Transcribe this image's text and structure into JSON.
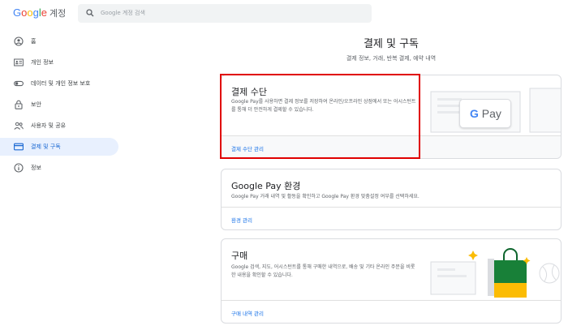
{
  "header": {
    "logo": {
      "g1": "G",
      "o1": "o",
      "o2": "o",
      "g2": "g",
      "l": "l",
      "e": "e",
      "account": "계정"
    },
    "search_placeholder": "Google 계정 검색"
  },
  "sidebar": {
    "items": [
      {
        "label": "홈",
        "icon": "home-icon"
      },
      {
        "label": "개인 정보",
        "icon": "id-card-icon"
      },
      {
        "label": "데이터 및 개인 정보 보호",
        "icon": "toggle-icon"
      },
      {
        "label": "보안",
        "icon": "lock-icon"
      },
      {
        "label": "사용자 및 공유",
        "icon": "people-icon"
      },
      {
        "label": "결제 및 구독",
        "icon": "credit-card-icon",
        "active": true
      },
      {
        "label": "정보",
        "icon": "info-icon"
      }
    ]
  },
  "main": {
    "title": "결제 및 구독",
    "subtitle": "결제 정보, 거래, 반복 결제, 예약 내역",
    "cards": [
      {
        "title": "결제 수단",
        "desc": "Google Pay를 사용하면 결제 정보를 저장하여 온라인/오프라인 상점에서 또는 어시스턴트를 통해 더 안전하게 결제할 수 있습니다.",
        "link": "결제 수단 관리",
        "badge": "Pay"
      },
      {
        "title": "Google Pay 환경",
        "desc": "Google Pay 거래 내역 및 활동을 확인하고 Google Pay 환경 맞춤설정 여부를 선택하세요.",
        "link": "환경 관리"
      },
      {
        "title": "구매",
        "desc": "Google 검색, 지도, 어시스턴트를 통해 구매한 내역으로, 배송 및 기타 온라인 주문을 비롯한 내용을 확인할 수 있습니다.",
        "link": "구매 내역 관리"
      }
    ]
  },
  "colors": {
    "accent": "#1a73e8",
    "highlight": "#e00000",
    "active_bg": "#e8f0fe"
  }
}
